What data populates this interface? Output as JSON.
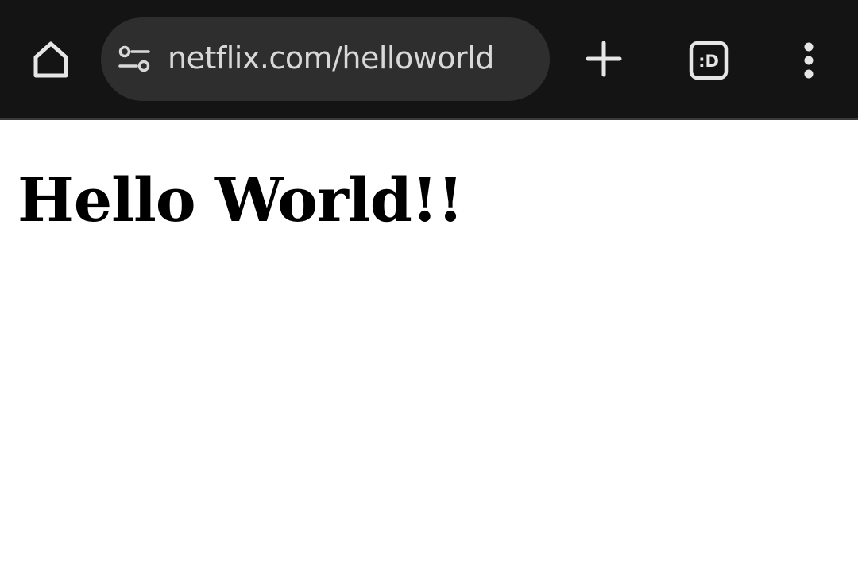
{
  "toolbar": {
    "home_icon": "home-icon",
    "site_settings_icon": "site-settings-icon",
    "url": "netflix.com/helloworld",
    "new_tab_icon": "plus-icon",
    "tab_switcher_label": ":D",
    "menu_icon": "kebab-menu-icon"
  },
  "page": {
    "heading": "Hello World!!"
  },
  "colors": {
    "toolbar_bg": "#141414",
    "urlbar_bg": "#2e2e2e",
    "icon": "#e6e6e6",
    "url_text": "#d8d8d8",
    "page_bg": "#ffffff",
    "heading": "#000000"
  }
}
